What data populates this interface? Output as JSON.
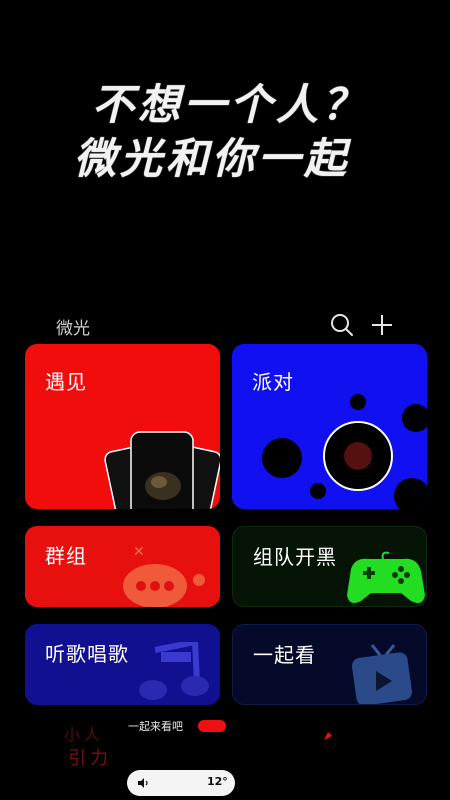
{
  "hero": {
    "line1": "不想一个人？",
    "line2": "微光和你一起"
  },
  "section": {
    "title": "微光",
    "search_icon": "search-icon",
    "add_icon": "plus-icon"
  },
  "cards": {
    "meet": {
      "label": "遇见"
    },
    "party": {
      "label": "派对"
    },
    "group": {
      "label": "群组"
    },
    "team": {
      "label": "组队开黑"
    },
    "music": {
      "label": "听歌唱歌"
    },
    "watch": {
      "label": "一起看"
    }
  },
  "colors": {
    "meet": "#f20d0d",
    "party": "#1010f0",
    "group": "#e8100e",
    "team": "#051405",
    "music": "#101090",
    "watch": "#050a2a",
    "gamepad": "#22dd22"
  },
  "mini_player": {
    "text": "一起来看吧",
    "badge": "",
    "arrow_icon": "play-arrow-icon"
  },
  "status_pill": {
    "icon": "sound-icon",
    "temperature": "12°"
  }
}
